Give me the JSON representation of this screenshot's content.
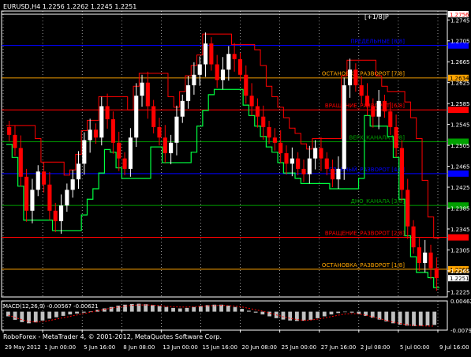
{
  "header": {
    "symbol_line": "EURUSD,H4  1.2256 1.2262 1.2245 1.2251",
    "mm_tag": "[+1/8]P"
  },
  "footer": {
    "copyright": "RoboForex - MetaTrader 4, © 2001-2012, MetaQuotes Software Corp."
  },
  "colors": {
    "background": "#000000",
    "bull_candle": "#FFFFFF",
    "bear_candle": "#FF0000",
    "support_line": "#00FF40",
    "resistance_line": "#FF0000",
    "grid": "#FFFFFF",
    "axis_text": "#FFFFFF",
    "macd_hist": "#C0C0C0",
    "macd_signal": "#FF0000"
  },
  "chart_data": [
    {
      "type": "candlestick",
      "title": "EURUSD,H4",
      "ohlc_header": {
        "open": 1.2256,
        "high": 1.2262,
        "low": 1.2245,
        "close": 1.2251
      },
      "ylim": [
        1.2215,
        1.2762
      ],
      "y_ticks": [
        1.2745,
        1.2705,
        1.2665,
        1.2625,
        1.2585,
        1.2545,
        1.2505,
        1.2465,
        1.2425,
        1.2385,
        1.2345,
        1.2305,
        1.2265,
        1.2225
      ],
      "x_ticks": [
        "29 May 2012",
        "1 Jun 00:00",
        "5 Jun 16:00",
        "8 Jun 08:00",
        "13 Jun 00:00",
        "15 Jun 16:00",
        "20 Jun 08:00",
        "25 Jun 00:00",
        "27 Jun 16:00",
        "2 Jul 08:00",
        "5 Jul 00:00",
        "9 Jul 16:00"
      ],
      "murrey_levels": [
        {
          "label": "[+1/8]P",
          "price": 1.2756,
          "color": "#FFFFFF",
          "badge_bg": "#FFFFFF",
          "badge_fg": "#FF0000"
        },
        {
          "label": "ПРЕДЕЛЬНЫЕ [8/8]",
          "price": 1.2696,
          "color": "#0000FF",
          "badge_bg": "#0000FF",
          "badge_fg": "#0000FF"
        },
        {
          "label": "ОСТАНОВКА_РАЗВОРОТ [7/8]",
          "price": 1.2634,
          "color": "#FFA500",
          "badge_bg": "#FFA500",
          "badge_fg": "#000000"
        },
        {
          "label": "ВРАЩЕНИЕ_РАЗВОРОТ [6/8]",
          "price": 1.2573,
          "color": "#FF0000",
          "badge_bg": "#FF0000",
          "badge_fg": "#FF0000"
        },
        {
          "label": "ВЕРХ_КАНАЛА [5/8]",
          "price": 1.2512,
          "color": "#00A000",
          "badge_bg": "#00A000",
          "badge_fg": "#00A000"
        },
        {
          "label": "ГЛАВНЫЙ_РАЗВОРОТ [4/8]",
          "price": 1.2451,
          "color": "#0000FF",
          "badge_bg": "#0000FF",
          "badge_fg": "#0000FF"
        },
        {
          "label": "ДНО_КАНАЛА [3/8]",
          "price": 1.239,
          "color": "#00A000",
          "badge_bg": "#00A000",
          "badge_fg": "#00A000"
        },
        {
          "label": "ВРАЩЕНИЕ_РАЗВОРОТ [2/8]",
          "price": 1.2329,
          "color": "#FF0000",
          "badge_bg": "#FF0000",
          "badge_fg": "#FF0000"
        },
        {
          "label": "ОСТАНОВКА_РАЗВОРОТ [1/8]",
          "price": 1.2268,
          "color": "#FFA500",
          "badge_bg": "#FFA500",
          "badge_fg": "#000000"
        }
      ],
      "last_price": 1.2251,
      "close_path": [
        1.2525,
        1.25,
        1.2445,
        1.238,
        1.242,
        1.2455,
        1.243,
        1.238,
        1.236,
        1.239,
        1.242,
        1.244,
        1.247,
        1.2515,
        1.2535,
        1.252,
        1.258,
        1.2555,
        1.251,
        1.248,
        1.246,
        1.252,
        1.26,
        1.2625,
        1.258,
        1.254,
        1.252,
        1.249,
        1.251,
        1.256,
        1.259,
        1.262,
        1.264,
        1.266,
        1.27,
        1.266,
        1.263,
        1.265,
        1.268,
        1.267,
        1.264,
        1.26,
        1.258,
        1.256,
        1.254,
        1.252,
        1.251,
        1.249,
        1.247,
        1.248,
        1.246,
        1.245,
        1.248,
        1.25,
        1.248,
        1.246,
        1.244,
        1.246,
        1.262,
        1.265,
        1.262,
        1.26,
        1.258,
        1.256,
        1.259,
        1.257,
        1.254,
        1.25,
        1.242,
        1.235,
        1.231,
        1.228,
        1.23,
        1.227,
        1.2251
      ]
    },
    {
      "type": "bar",
      "title": "MACD(12,26,9) -0.00567 -0.00621",
      "ylim": [
        -0.00795,
        0.00462
      ],
      "y_ticks": [
        0.00462,
        -0.00795
      ],
      "histogram": [
        -0.002,
        -0.0035,
        -0.0045,
        -0.005,
        -0.0046,
        -0.0038,
        -0.003,
        -0.0024,
        -0.0018,
        -0.0012,
        -0.0008,
        -0.0004,
        0.0002,
        0.0008,
        0.0014,
        0.002,
        0.0026,
        0.003,
        0.0033,
        0.0034,
        0.0032,
        0.0028,
        0.0024,
        0.002,
        0.0016,
        0.0014,
        0.0016,
        0.002,
        0.0024,
        0.0028,
        0.003,
        0.003,
        0.0026,
        0.002,
        0.0012,
        0.0004,
        -0.0004,
        -0.0012,
        -0.002,
        -0.0028,
        -0.0034,
        -0.0038,
        -0.004,
        -0.0039,
        -0.0035,
        -0.0028,
        -0.002,
        -0.0012,
        -0.0006,
        -0.0002,
        -0.0004,
        -0.001,
        -0.0018,
        -0.0026,
        -0.0034,
        -0.0042,
        -0.005,
        -0.0056,
        -0.006,
        -0.0062,
        -0.0061,
        -0.0059,
        -0.0057
      ],
      "signal": [
        -0.0015,
        -0.0025,
        -0.0035,
        -0.0042,
        -0.0045,
        -0.0043,
        -0.0038,
        -0.0032,
        -0.0026,
        -0.002,
        -0.0014,
        -0.0008,
        -0.0002,
        0.0004,
        0.001,
        0.0015,
        0.002,
        0.0024,
        0.0027,
        0.0029,
        0.0029,
        0.0028,
        0.0026,
        0.0023,
        0.0021,
        0.002,
        0.002,
        0.0021,
        0.0023,
        0.0025,
        0.0026,
        0.0027,
        0.0026,
        0.0024,
        0.002,
        0.0014,
        0.0008,
        0.0002,
        -0.0006,
        -0.0014,
        -0.0022,
        -0.0029,
        -0.0034,
        -0.0037,
        -0.0036,
        -0.0032,
        -0.0027,
        -0.0021,
        -0.0015,
        -0.001,
        -0.0008,
        -0.001,
        -0.0015,
        -0.0022,
        -0.003,
        -0.0038,
        -0.0045,
        -0.0051,
        -0.0056,
        -0.0059,
        -0.0061,
        -0.0062,
        -0.0062
      ]
    }
  ]
}
